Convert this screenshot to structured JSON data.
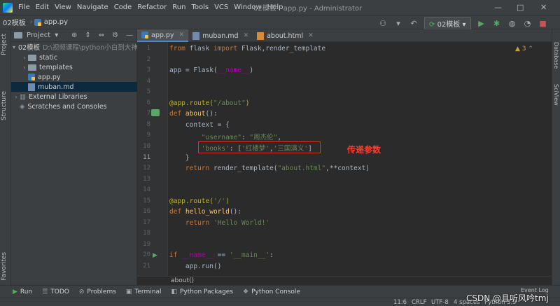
{
  "window": {
    "title": "02模板 - app.py - Administrator",
    "menu": [
      "File",
      "Edit",
      "View",
      "Navigate",
      "Code",
      "Refactor",
      "Run",
      "Tools",
      "VCS",
      "Window",
      "Help"
    ],
    "controls": [
      "—",
      "□",
      "✕"
    ]
  },
  "navbar": {
    "project": "02模板",
    "file": "app.py",
    "run_config": "02模板"
  },
  "left_strip": {
    "project_tab": "Project",
    "structure_tab": "Structure",
    "favorites_tab": "Favorites"
  },
  "right_strip": {
    "database_tab": "Database",
    "sciview_tab": "SciView"
  },
  "project_panel": {
    "header": "Project",
    "tree": [
      {
        "label": "02模板",
        "path": "D:\\视频课程\\python小白到大神",
        "icon": "folder",
        "expanded": true,
        "depth": 0
      },
      {
        "label": "static",
        "icon": "folder",
        "depth": 1
      },
      {
        "label": "templates",
        "icon": "folder",
        "depth": 1
      },
      {
        "label": "app.py",
        "icon": "py",
        "depth": 1
      },
      {
        "label": "muban.md",
        "icon": "md",
        "depth": 1,
        "selected": true
      },
      {
        "label": "External Libraries",
        "icon": "lib",
        "depth": 0
      },
      {
        "label": "Scratches and Consoles",
        "icon": "scratch",
        "depth": 0
      }
    ]
  },
  "tabs": [
    {
      "label": "app.py",
      "icon": "py",
      "active": true
    },
    {
      "label": "muban.md",
      "icon": "md",
      "active": false
    },
    {
      "label": "about.html",
      "icon": "html",
      "active": false
    }
  ],
  "editor": {
    "inspection_count": "3",
    "line_numbers": [
      "1",
      "2",
      "3",
      "4",
      "5",
      "6",
      "7",
      "8",
      "9",
      "10",
      "11",
      "12",
      "13",
      "14",
      "15",
      "16",
      "17",
      "18",
      "19",
      "20",
      "21"
    ],
    "breadcrumb": "about()"
  },
  "annotation": "传递参数",
  "bottom_tools": [
    "Run",
    "TODO",
    "Problems",
    "Terminal",
    "Python Packages",
    "Python Console"
  ],
  "status": {
    "position": "11:6",
    "line_sep": "CRLF",
    "encoding": "UTF-8",
    "indent": "4 spaces",
    "interpreter": "Python 3.9",
    "event_log": "Event Log"
  },
  "watermark": "CSDN @且听风吟tmj",
  "colors": {
    "keyword": "#cc7832",
    "string": "#6a8759",
    "decorator": "#bbb529",
    "function": "#ffc66d",
    "highlight_box": "#e0302a",
    "annotation": "#ff3b30"
  }
}
